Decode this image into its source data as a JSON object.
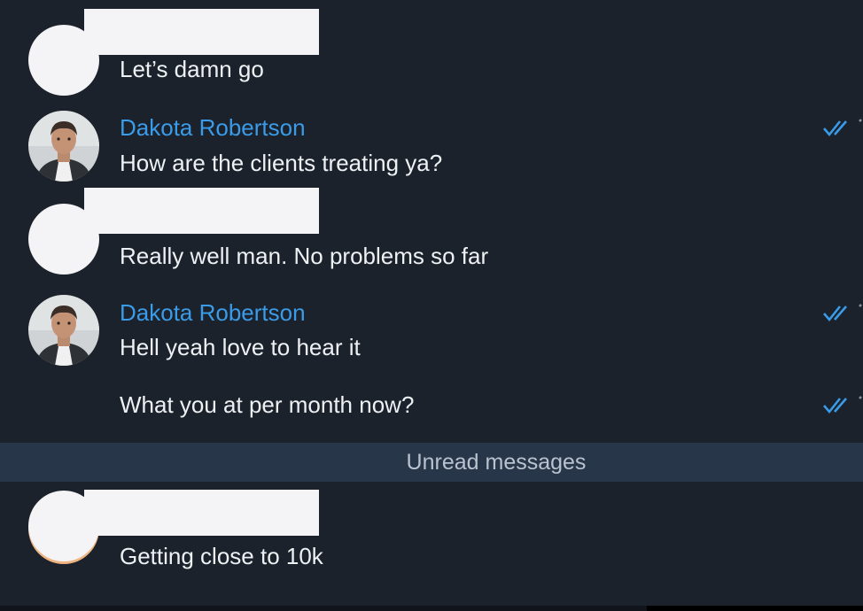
{
  "messages": [
    {
      "sender": "",
      "text": "Let’s damn go",
      "redacted": true
    },
    {
      "sender": "Dakota Robertson",
      "text": "How are the clients treating ya?",
      "read": true
    },
    {
      "sender": "",
      "text": "Really well man. No problems so far",
      "redacted": true
    },
    {
      "sender": "Dakota Robertson",
      "text": "Hell yeah love to hear it",
      "read": true
    },
    {
      "sender": "Dakota Robertson",
      "text": "What you at per month now?",
      "read": true
    },
    {
      "sender": "",
      "text": "Getting close to 10k",
      "redacted": true
    }
  ],
  "divider": {
    "label": "Unread messages"
  },
  "colors": {
    "background": "#1c222b",
    "sender_name": "#3a9be8",
    "message_text": "#eef1f4",
    "read_ticks": "#3a9be8",
    "divider_bg": "#28364a",
    "divider_text": "#b9c3cf",
    "redaction": "#f4f4f6"
  },
  "icons": {
    "read_receipt": "double-check-icon",
    "avatar": "contact-photo"
  }
}
